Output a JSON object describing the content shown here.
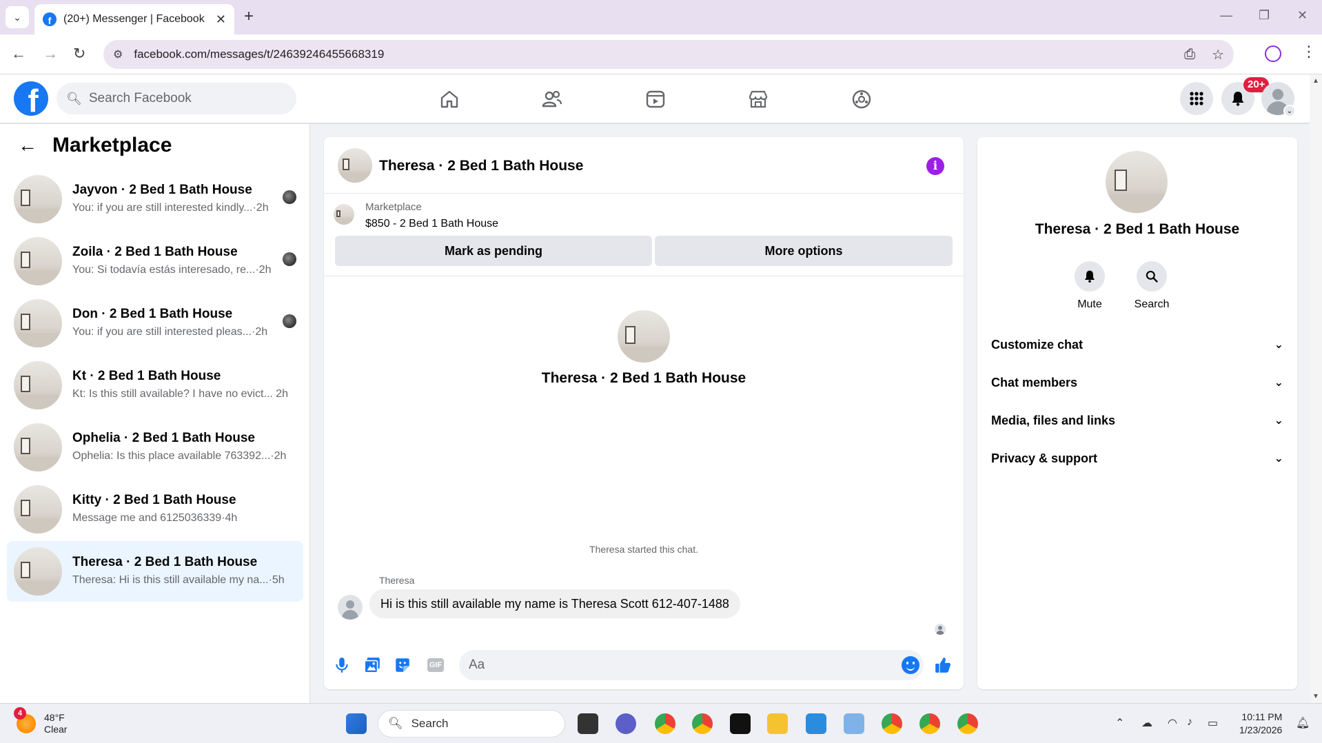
{
  "browser": {
    "tab_title": "(20+) Messenger | Facebook",
    "url": "facebook.com/messages/t/24639246455668319"
  },
  "fb_header": {
    "search_placeholder": "Search Facebook",
    "notification_badge": "20+"
  },
  "left_panel": {
    "title": "Marketplace",
    "conversations": [
      {
        "name": "Jayvon · 2 Bed 1 Bath House",
        "preview": "You: if you are still interested kindly...",
        "time": "·2h"
      },
      {
        "name": "Zoila · 2 Bed 1 Bath House",
        "preview": "You: Si todavía estás interesado, re...",
        "time": "·2h"
      },
      {
        "name": "Don · 2 Bed 1 Bath House",
        "preview": "You: if you are still interested pleas...",
        "time": "·2h"
      },
      {
        "name": "Kt · 2 Bed 1 Bath House",
        "preview": "Kt: Is this still available? I have no evict...",
        "time": "2h"
      },
      {
        "name": "Ophelia · 2 Bed 1 Bath House",
        "preview": "Ophelia: Is this place available 763392...",
        "time": "·2h"
      },
      {
        "name": "Kitty · 2 Bed 1 Bath House",
        "preview": "Message me and 6125036339",
        "time": "·4h"
      },
      {
        "name": "Theresa · 2 Bed 1 Bath House",
        "preview": "Theresa: Hi is this still available my na...",
        "time": "·5h"
      }
    ]
  },
  "chat": {
    "title": "Theresa · 2 Bed 1 Bath House",
    "marketplace_label": "Marketplace",
    "listing": "$850 - 2 Bed 1 Bath House",
    "mark_pending": "Mark as pending",
    "more_options": "More options",
    "center_name": "Theresa · 2 Bed 1 Bath House",
    "started_text": "Theresa started this chat.",
    "sender": "Theresa",
    "message": "Hi is this still available my name is Theresa Scott 612-407-1488",
    "gif_label": "GIF",
    "input_placeholder": "Aa"
  },
  "right_panel": {
    "name": "Theresa · 2 Bed 1 Bath House",
    "mute": "Mute",
    "search": "Search",
    "sections": [
      "Customize chat",
      "Chat members",
      "Media, files and links",
      "Privacy & support"
    ]
  },
  "taskbar": {
    "weather_badge": "4",
    "temperature": "48°F",
    "condition": "Clear",
    "search": "Search",
    "time": "10:11 PM",
    "date": "1/23/2026"
  },
  "colors": {
    "fb_blue": "#1877f2",
    "info_purple": "#9b1fe8",
    "active_row": "#ebf5ff",
    "badge_red": "#e41e3f"
  }
}
